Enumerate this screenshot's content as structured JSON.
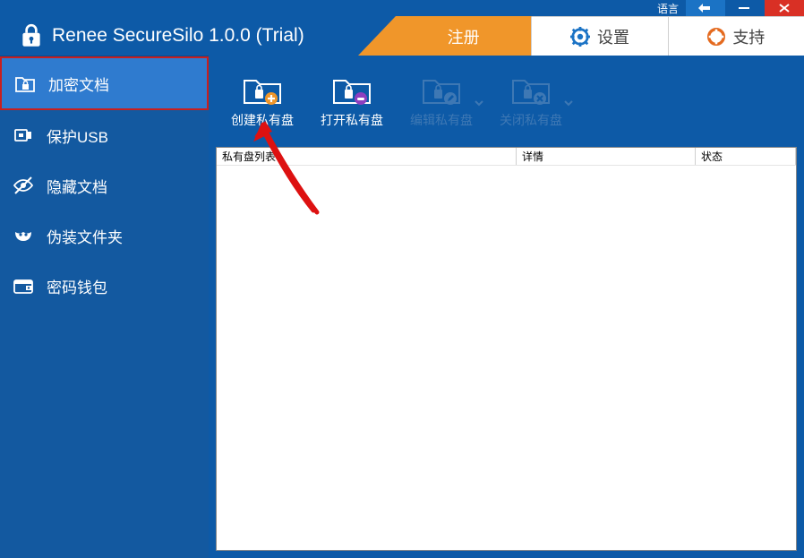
{
  "topstrip": {
    "language_label": "语言"
  },
  "app": {
    "title": "Renee SecureSilo 1.0.0 (Trial)"
  },
  "header_tabs": {
    "register": "注册",
    "settings": "设置",
    "support": "支持"
  },
  "sidebar": {
    "items": [
      {
        "label": "加密文档"
      },
      {
        "label": "保护USB"
      },
      {
        "label": "隐藏文档"
      },
      {
        "label": "伪装文件夹"
      },
      {
        "label": "密码钱包"
      }
    ]
  },
  "toolbar": {
    "buttons": [
      {
        "label": "创建私有盘"
      },
      {
        "label": "打开私有盘"
      },
      {
        "label": "编辑私有盘"
      },
      {
        "label": "关闭私有盘"
      }
    ]
  },
  "listview": {
    "columns": {
      "name": "私有盘列表",
      "detail": "详情",
      "status": "状态"
    }
  }
}
